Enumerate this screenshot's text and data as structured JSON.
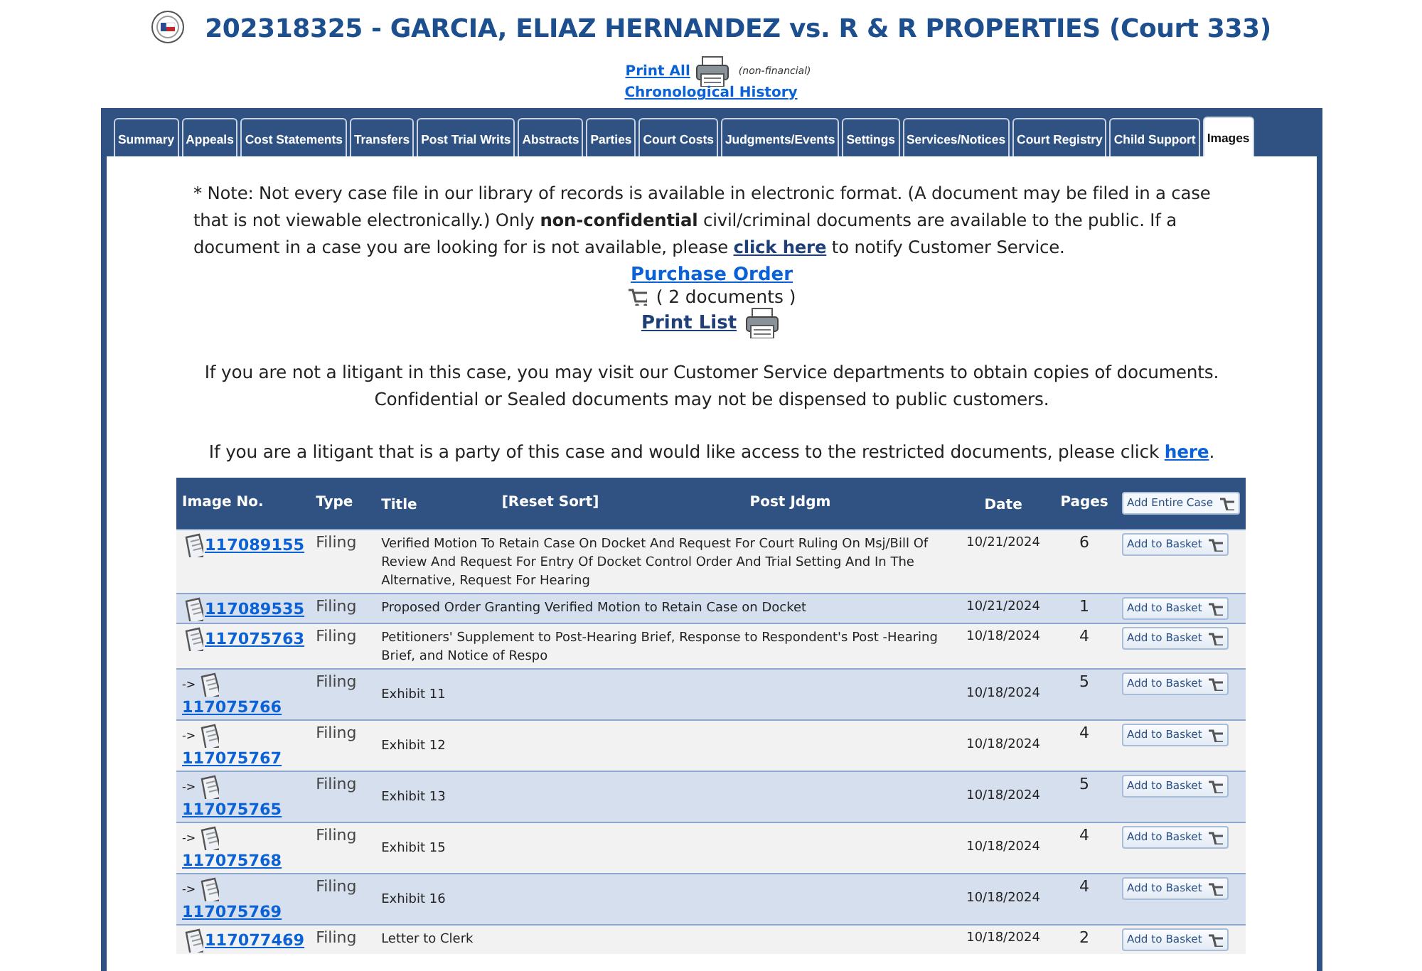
{
  "header": {
    "title": "202318325 - GARCIA, ELIAZ HERNANDEZ vs. R & R PROPERTIES (Court 333)",
    "print_all": "Print All",
    "print_note": "(non-financial)",
    "chronological": "Chronological History"
  },
  "tabs": [
    {
      "label": "Summary",
      "selected": false
    },
    {
      "label": "Appeals",
      "selected": false
    },
    {
      "label": "Cost Statements",
      "selected": false
    },
    {
      "label": "Transfers",
      "selected": false
    },
    {
      "label": "Post Trial Writs",
      "selected": false
    },
    {
      "label": "Abstracts",
      "selected": false
    },
    {
      "label": "Parties",
      "selected": false
    },
    {
      "label": "Court Costs",
      "selected": false
    },
    {
      "label": "Judgments/Events",
      "selected": false
    },
    {
      "label": "Settings",
      "selected": false
    },
    {
      "label": "Services/Notices",
      "selected": false
    },
    {
      "label": "Court Registry",
      "selected": false
    },
    {
      "label": "Child Support",
      "selected": false
    },
    {
      "label": "Images",
      "selected": true
    }
  ],
  "note": {
    "before": "* Note: Not every case file in our library of records is available in electronic format. (A document may be filed in a case that is not viewable electronically.) Only **non-confidential** civil/criminal documents are available to the public. If a document in a case you are looking for is not available, please",
    "link": "click here",
    "after": "to notify Customer Service."
  },
  "purchase_order": "Purchase Order",
  "basket_count": "( 2 documents )",
  "print_list": "Print List",
  "info": "If you are not a litigant in this case, you may visit our Customer Service departments to obtain copies of documents. Confidential or Sealed documents may not be dispensed to public customers.",
  "litigant": {
    "text": "If you are a litigant that is a party of this case and would like access to the restricted documents, please click",
    "link": "here",
    "end": "."
  },
  "table": {
    "columns": [
      "Image No.",
      "Type",
      "Title",
      "[Reset Sort]",
      "Post Jdgm",
      "Date",
      "Pages"
    ],
    "add_case": "Add Entire Case",
    "rows": [
      {
        "kind": "document",
        "image_no": "117089155",
        "type": "Filing",
        "title": "Verified Motion To Retain Case On Docket And Request For Court Ruling On Msj/Bill Of Review And Request For Entry Of Docket Control Order And Trial Setting And In The Alternative, Request For Hearing",
        "date": "10/21/2024",
        "pages": "6",
        "button": "Add to Basket"
      },
      {
        "kind": "document",
        "image_no": "117089535",
        "type": "Filing",
        "title": "Proposed Order Granting Verified Motion to Retain Case on Docket",
        "date": "10/21/2024",
        "pages": "1",
        "button": "Add to Basket"
      },
      {
        "kind": "document",
        "image_no": "117075763",
        "type": "Filing",
        "title": "Petitioners' Supplement to Post-Hearing Brief, Response to Respondent's Post -Hearing Brief, and Notice of Respo",
        "date": "10/18/2024",
        "pages": "4",
        "button": "Add to Basket"
      },
      {
        "kind": "attachment",
        "arrow": "->",
        "image_no": "117075766",
        "type": "Filing",
        "title": "Exhibit 11",
        "date": "10/18/2024",
        "pages": "5",
        "button": "Add to Basket"
      },
      {
        "kind": "attachment",
        "arrow": "->",
        "image_no": "117075767",
        "type": "Filing",
        "title": "Exhibit 12",
        "date": "10/18/2024",
        "pages": "4",
        "button": "Add to Basket"
      },
      {
        "kind": "attachment",
        "arrow": "->",
        "image_no": "117075765",
        "type": "Filing",
        "title": "Exhibit 13",
        "date": "10/18/2024",
        "pages": "5",
        "button": "Add to Basket"
      },
      {
        "kind": "attachment",
        "arrow": "->",
        "image_no": "117075768",
        "type": "Filing",
        "title": "Exhibit 15",
        "date": "10/18/2024",
        "pages": "4",
        "button": "Add to Basket"
      },
      {
        "kind": "attachment",
        "arrow": "->",
        "image_no": "117075769",
        "type": "Filing",
        "title": "Exhibit 16",
        "date": "10/18/2024",
        "pages": "4",
        "button": "Add to Basket"
      },
      {
        "kind": "document",
        "image_no": "117077469",
        "type": "Filing",
        "title": "Letter to Clerk",
        "date": "10/18/2024",
        "pages": "2",
        "button": "Add to Basket"
      }
    ]
  }
}
